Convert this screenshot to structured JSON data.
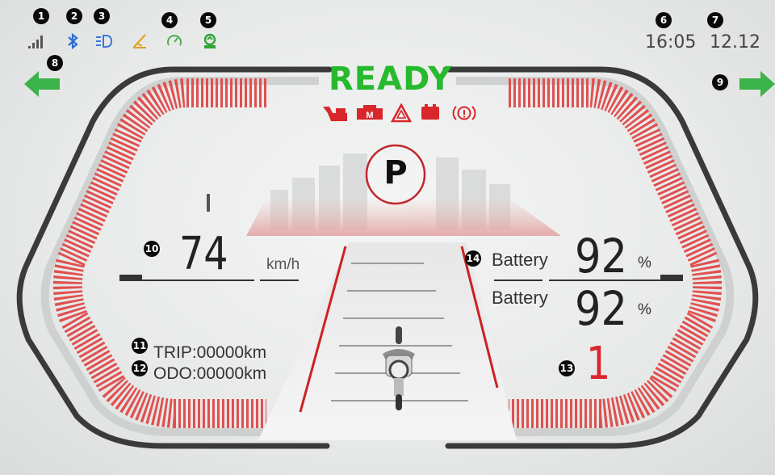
{
  "status_bar": {
    "icons": [
      "signal-icon",
      "bluetooth-icon",
      "headlight-icon",
      "side-stand-icon",
      "cruise-icon",
      "eco-mode-icon"
    ],
    "time": "16:05",
    "date": "12.12"
  },
  "status": {
    "ready_label": "READY"
  },
  "warnings": [
    "motor-temp-warning-icon",
    "motor-fault-icon",
    "hazard-warning-icon",
    "battery-warning-icon",
    "brake-warning-icon"
  ],
  "warning_texts": {
    "motor_fault_letter": "M"
  },
  "gear": {
    "value": "P"
  },
  "speed": {
    "value": "74",
    "unit": "km/h"
  },
  "battery": {
    "primary": {
      "label": "Battery",
      "value": "92",
      "unit": "%"
    },
    "secondary": {
      "label": "Battery",
      "value": "92",
      "unit": "%"
    }
  },
  "gear_level": {
    "value": "1"
  },
  "odometer": {
    "trip": "TRIP:00000km",
    "odo": "ODO:00000km"
  },
  "markers": [
    "1",
    "2",
    "3",
    "4",
    "5",
    "6",
    "7",
    "8",
    "9",
    "10",
    "11",
    "12",
    "13",
    "14"
  ],
  "colors": {
    "ready": "#27b92e",
    "arrow": "#3cb34a",
    "warning": "#d8262b",
    "gauge": "#e05050",
    "ring": "#3a3a3a"
  }
}
